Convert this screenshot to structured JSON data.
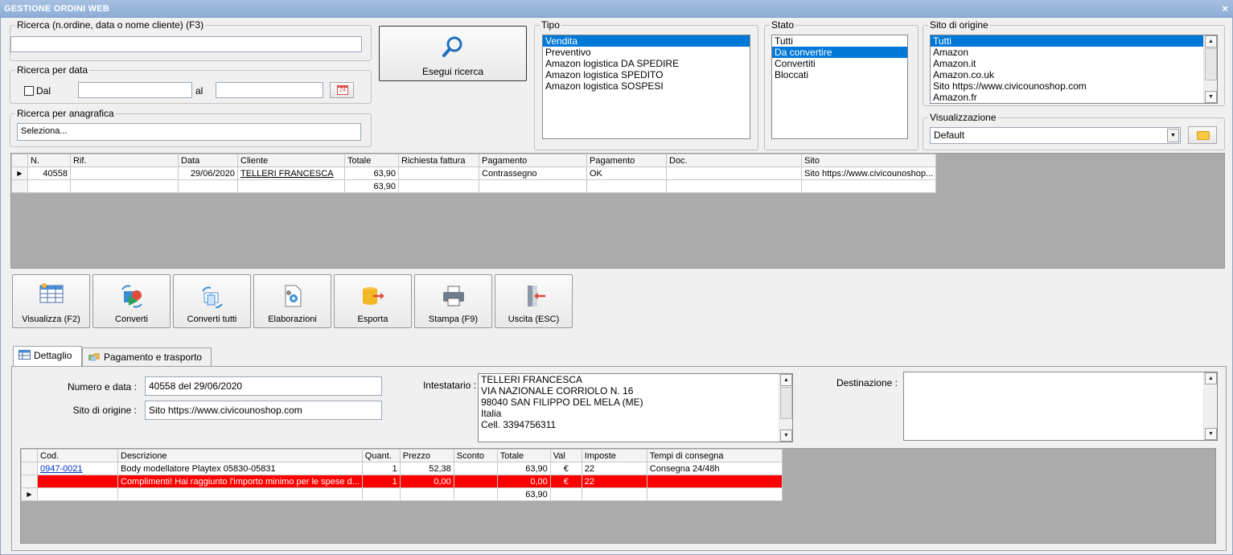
{
  "window": {
    "title": "GESTIONE ORDINI WEB",
    "close": "×"
  },
  "search": {
    "legend": "Ricerca (n.ordine, data o nome cliente) (F3)",
    "value": "",
    "date_legend": "Ricerca per data",
    "dal_label": "Dal",
    "dal_checked": false,
    "dal_value": "",
    "al_label": "al",
    "al_value": "",
    "calendar_icon_text": "24",
    "anagrafica_legend": "Ricerca per anagrafica",
    "anagrafica_value": "Seleziona...",
    "run_button": "Esegui ricerca"
  },
  "tipo": {
    "legend": "Tipo",
    "items": [
      "Vendita",
      "Preventivo",
      "Amazon logistica DA SPEDIRE",
      "Amazon logistica SPEDITO",
      "Amazon logistica SOSPESI"
    ],
    "selected": 0
  },
  "stato": {
    "legend": "Stato",
    "items": [
      "Tutti",
      "Da convertire",
      "Convertiti",
      "Bloccati"
    ],
    "selected": 1
  },
  "sito": {
    "legend": "Sito di origine",
    "items": [
      "Tutti",
      "Amazon",
      "Amazon.it",
      "Amazon.co.uk",
      "Sito https://www.civicounoshop.com",
      "Amazon.fr"
    ],
    "selected": 0
  },
  "visualizzazione": {
    "legend": "Visualizzazione",
    "value": "Default"
  },
  "orders": {
    "headers": [
      "N.",
      "Rif.",
      "Data",
      "Cliente",
      "Totale",
      "Richiesta fattura",
      "Pagamento",
      "Pagamento",
      "Doc.",
      "Sito"
    ],
    "rows": [
      [
        "40558",
        "",
        "29/06/2020",
        "TELLERI FRANCESCA",
        "63,90",
        "",
        "Contrassegno",
        "OK",
        "",
        "Sito https://www.civicounoshop..."
      ]
    ],
    "total": "63,90"
  },
  "toolbar": [
    "Visualizza (F2)",
    "Converti",
    "Converti tutti",
    "Elaborazioni",
    "Esporta",
    "Stampa (F9)",
    "Uscita (ESC)"
  ],
  "tabs": [
    "Dettaglio",
    "Pagamento e trasporto"
  ],
  "detail": {
    "numero_label": "Numero e data :",
    "numero_value": "40558 del 29/06/2020",
    "sito_label": "Sito di origine :",
    "sito_value": "Sito https://www.civicounoshop.com",
    "intestatario_label": "Intestatario :",
    "intestatario_lines": [
      "TELLERI FRANCESCA",
      "VIA NAZIONALE CORRIOLO N. 16",
      "98040 SAN FILIPPO DEL MELA (ME)",
      "Italia",
      "Cell. 3394756311"
    ],
    "destinazione_label": "Destinazione :",
    "destinazione_value": ""
  },
  "items": {
    "headers": [
      "Cod.",
      "Descrizione",
      "Quant.",
      "Prezzo",
      "Sconto",
      "Totale",
      "Val",
      "Imposte",
      "Tempi di consegna"
    ],
    "rows": [
      [
        "0947-0021",
        "Body modellatore Playtex 05830-05831",
        "1",
        "52,38",
        "",
        "63,90",
        "€",
        "22",
        "Consegna 24/48h"
      ],
      [
        "",
        "Complimenti! Hai raggiunto l'importo minimo per le spese d...",
        "1",
        "0,00",
        "",
        "0,00",
        "€",
        "22",
        ""
      ]
    ],
    "total": "63,90"
  }
}
